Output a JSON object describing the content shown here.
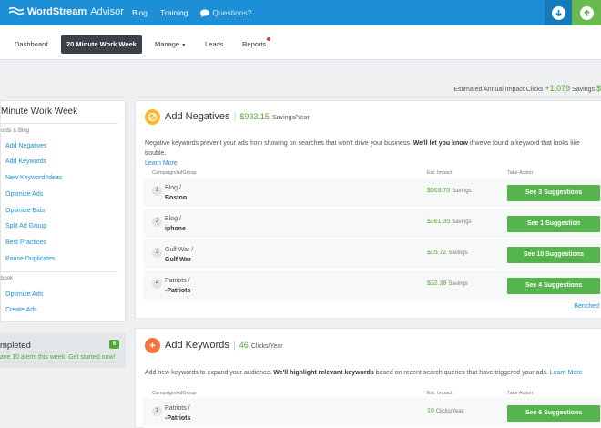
{
  "topbar": {
    "brand": "WordStream",
    "brand_sub": "Advisor",
    "nav": [
      "Blog",
      "Training"
    ],
    "questions": "Questions?",
    "download_icon": "arrow-down-circle-icon",
    "upgrade_icon": "arrow-up-circle-icon"
  },
  "tabs": {
    "dashboard": "Dashboard",
    "active": "20 Minute Work Week",
    "manage": "Manage",
    "leads": "Leads",
    "reports": "Reports"
  },
  "impact": {
    "label": "Estimated Annual Impact",
    "clicks_label": "Clicks",
    "clicks_value": "+1,079",
    "savings_label": "Savings",
    "savings_value": "$"
  },
  "sidebar": {
    "title": "Minute Work Week",
    "section1": "ords & Bing",
    "items1": [
      "Add Negatives",
      "Add Keywords",
      "New Keyword Ideas",
      "Optimize Ads",
      "Optimize Bids",
      "Split Ad Group",
      "Best Practices",
      "Pause Duplicates"
    ],
    "section2": "book",
    "items2": [
      "Optimize Ads",
      "Create Ads"
    ]
  },
  "completed": {
    "title": "mpleted",
    "subtitle": "ave 10 alerts this week! Get started now!",
    "badge": "6"
  },
  "negatives": {
    "title": "Add Negatives",
    "savings": "$933.15",
    "savings_unit": "Savings/Year",
    "desc_pre": "Negative keywords prevent your ads from showing on searches that won't drive your business.",
    "desc_bold": "We'll let you know",
    "desc_post": "if we've found a keyword that looks like trouble.",
    "learn_more": "Learn More",
    "headers": [
      "Campaign/AdGroup",
      "Est. Impact",
      "Take Action"
    ],
    "rows": [
      {
        "num": "1",
        "campaign": "Blog /",
        "adgroup": "Boston",
        "impact": "$503.70",
        "unit": "Savings",
        "action": "See 3 Suggestions"
      },
      {
        "num": "2",
        "campaign": "Blog /",
        "adgroup": "iphone",
        "impact": "$361.35",
        "unit": "Savings",
        "action": "See 1 Suggestion"
      },
      {
        "num": "3",
        "campaign": "Gulf War /",
        "adgroup": "Gulf War",
        "impact": "$35.72",
        "unit": "Savings",
        "action": "See 10 Suggestions"
      },
      {
        "num": "4",
        "campaign": "Patriots /",
        "adgroup": "-Patriots",
        "impact": "$32.38",
        "unit": "Savings",
        "action": "See 4 Suggestions"
      }
    ],
    "benched": "Benched"
  },
  "keywords": {
    "title": "Add Keywords",
    "clicks": "46",
    "clicks_unit": "Clicks/Year",
    "desc_pre": "Add new keywords to expand your audience.",
    "desc_bold": "We'll highlight relevant keywords",
    "desc_post": "based on recent search queries that have triggered your ads.",
    "learn_more": "Learn More",
    "headers": [
      "Campaign/AdGroup",
      "Est. Impact",
      "Take Action"
    ],
    "rows": [
      {
        "num": "1",
        "campaign": "Patriots /",
        "adgroup": "-Patriots",
        "impact": "10",
        "unit": "Clicks/Year",
        "action": "See 6 Suggestions"
      }
    ]
  },
  "colors": {
    "primary": "#1c8fd6",
    "green": "#55b44b",
    "negatives_icon": "#f5b82e",
    "keywords_icon": "#f0753f"
  }
}
